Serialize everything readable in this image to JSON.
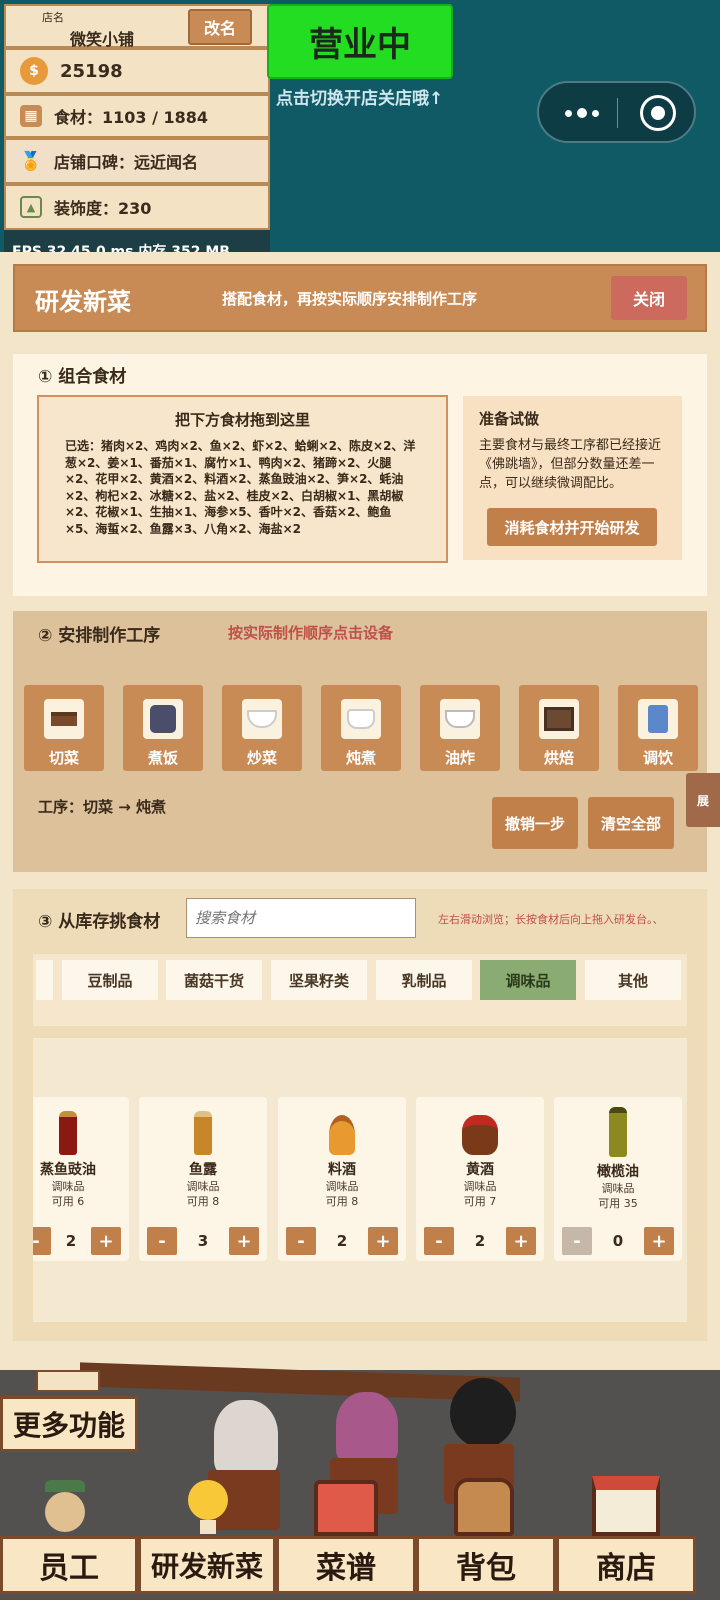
{
  "shop": {
    "name_label": "店名",
    "name": "微笑小铺",
    "rename_button": "改名",
    "coins": "25198",
    "ingredients": "食材：1103 / 1884",
    "reputation": "店铺口碑：远近闻名",
    "decoration": "装饰度：230",
    "fps_text": "FPS 32  45.0 ms  内存 352 MB"
  },
  "status": {
    "open_label": "营业中",
    "hint": "点击切换开店关店哦↑",
    "open_color": "#22dd22"
  },
  "capsule": {
    "more_icon": "more-icon",
    "target_icon": "target-icon"
  },
  "dialog": {
    "title": "研发新菜",
    "subtitle": "搭配食材，再按实际顺序安排制作工序",
    "close_button": "关闭"
  },
  "section1": {
    "heading": "① 组合食材",
    "drop_title": "把下方食材拖到这里",
    "selected_text": "已选：猪肉×2、鸡肉×2、鱼×2、虾×2、蛤蜊×2、陈皮×2、洋葱×2、姜×1、番茄×1、腐竹×1、鸭肉×2、猪蹄×2、火腿×2、花甲×2、黄酒×2、料酒×2、蒸鱼豉油×2、笋×2、蚝油×2、枸杞×2、冰糖×2、盐×2、桂皮×2、白胡椒×1、黑胡椒×2、花椒×1、生抽×1、海参×5、香叶×2、香菇×2、鲍鱼×5、海蜇×2、鱼露×3、八角×2、海盐×2",
    "ready_title": "准备试做",
    "ready_text": "主要食材与最终工序都已经接近《佛跳墙》，但部分数量还差一点，可以继续微调配比。",
    "start_button": "消耗食材并开始研发"
  },
  "section2": {
    "heading": "② 安排制作工序",
    "hint": "按实际制作顺序点击设备",
    "equipment": [
      {
        "label": "切菜",
        "icon": "cutting-table-icon"
      },
      {
        "label": "煮饭",
        "icon": "rice-cooker-icon"
      },
      {
        "label": "炒菜",
        "icon": "wok-icon"
      },
      {
        "label": "炖煮",
        "icon": "stew-pot-icon"
      },
      {
        "label": "油炸",
        "icon": "fryer-icon"
      },
      {
        "label": "烘焙",
        "icon": "oven-icon"
      },
      {
        "label": "调饮",
        "icon": "drink-machine-icon"
      }
    ],
    "process": "工序：切菜 → 炖煮",
    "undo_button": "撤销一步",
    "clear_button": "清空全部",
    "side_tab": "展"
  },
  "section3": {
    "heading": "③ 从库存挑食材",
    "search_placeholder": "搜索食材",
    "hint": "左右滑动浏览；长按食材后向上拖入研发台。、",
    "categories": [
      "豆制品",
      "菌菇干货",
      "坚果籽类",
      "乳制品",
      "调味品",
      "其他"
    ],
    "active_category": "调味品",
    "items": [
      {
        "name": "蒸鱼豉油",
        "type": "调味品",
        "avail": "可用 6",
        "qty": "2",
        "icon": "soy-sauce-bottle-icon"
      },
      {
        "name": "鱼露",
        "type": "调味品",
        "avail": "可用 8",
        "qty": "3",
        "icon": "fish-sauce-bottle-icon"
      },
      {
        "name": "料酒",
        "type": "调味品",
        "avail": "可用 8",
        "qty": "2",
        "icon": "cooking-wine-bottle-icon"
      },
      {
        "name": "黄酒",
        "type": "调味品",
        "avail": "可用 7",
        "qty": "2",
        "icon": "wine-jar-icon"
      },
      {
        "name": "橄榄油",
        "type": "调味品",
        "avail": "可用 35",
        "qty": "0",
        "icon": "olive-oil-bottle-icon"
      }
    ]
  },
  "game": {
    "more_features": "更多功能",
    "nav": [
      "员工",
      "研发新菜",
      "菜谱",
      "背包",
      "商店"
    ]
  }
}
